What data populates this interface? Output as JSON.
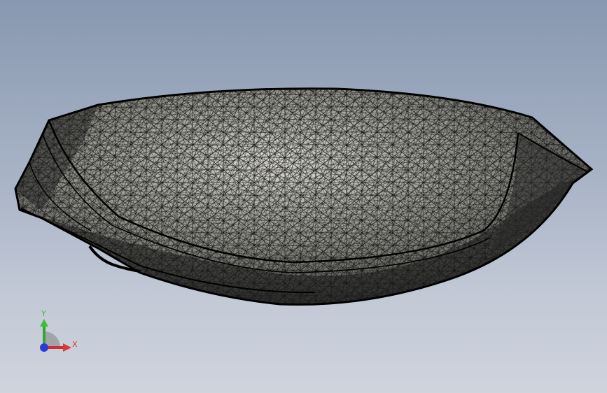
{
  "viewport": {
    "background_top": "#8898b0",
    "background_bottom": "#cfd4dd"
  },
  "model": {
    "mesh_color": "#111111",
    "surface_color": "#bdbdb3",
    "style": "wireframe-triangulated-mesh"
  },
  "triad": {
    "x_label": "X",
    "y_label": "Y",
    "x_color": "#d83a3a",
    "y_color": "#3bbf3b",
    "z_color": "#2a3ad8"
  }
}
